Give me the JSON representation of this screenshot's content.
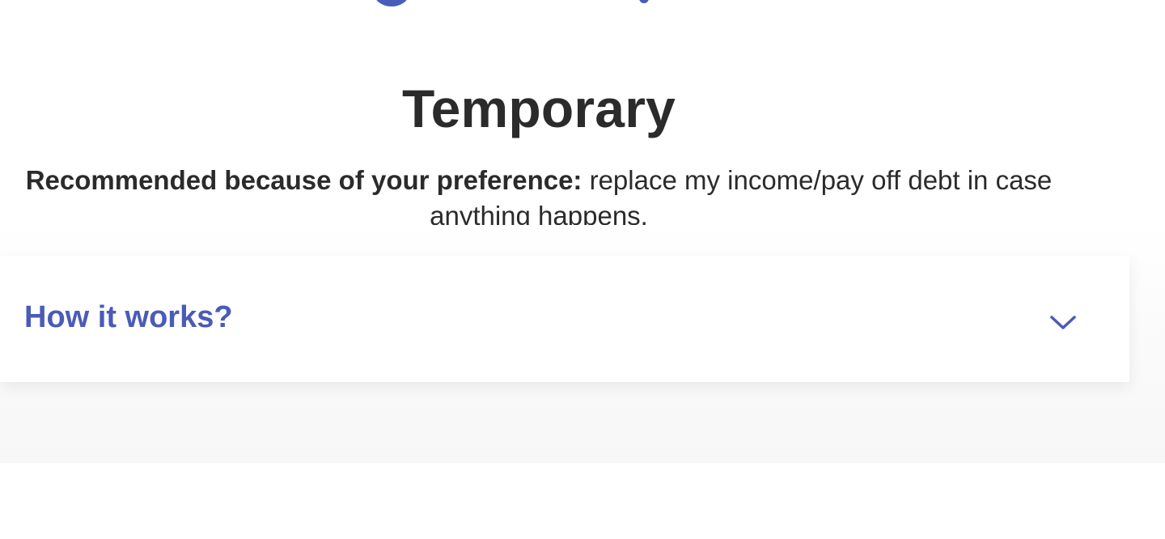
{
  "title": "Temporary",
  "recommendation": {
    "lead": "Recommended because of your preference:",
    "text": " replace my income/pay off debt in case anything happens."
  },
  "accordion": {
    "title": "How it works?",
    "toggle_icon": "chevron-down-icon"
  },
  "colors": {
    "brand": "#4a5bb8",
    "text": "#2b2b2b",
    "background": "#ffffff",
    "band": "#f7f7f7"
  }
}
